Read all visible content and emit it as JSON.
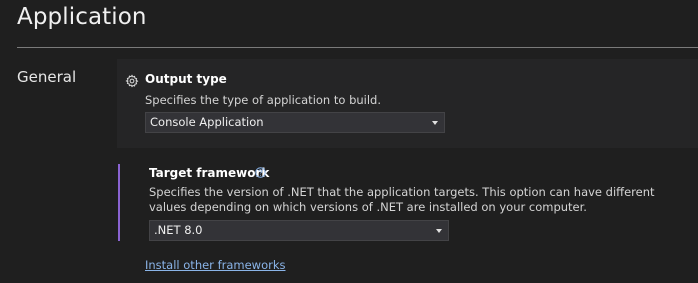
{
  "page": {
    "title": "Application"
  },
  "section": {
    "label": "General"
  },
  "output_type": {
    "icon": "gear-icon",
    "title": "Output type",
    "description": "Specifies the type of application to build.",
    "selected": "Console Application"
  },
  "target_framework": {
    "title": "Target framework",
    "help_icon": "help-circle-icon",
    "description": "Specifies the version of .NET that the application targets. This option can have different values depending on which versions of .NET are installed on your computer.",
    "selected": ".NET 8.0"
  },
  "install_link": {
    "label": "Install other frameworks"
  },
  "colors": {
    "background": "#1f1f1f",
    "card": "#252526",
    "accent": "#8a63d2",
    "link": "#8ab4e8"
  }
}
